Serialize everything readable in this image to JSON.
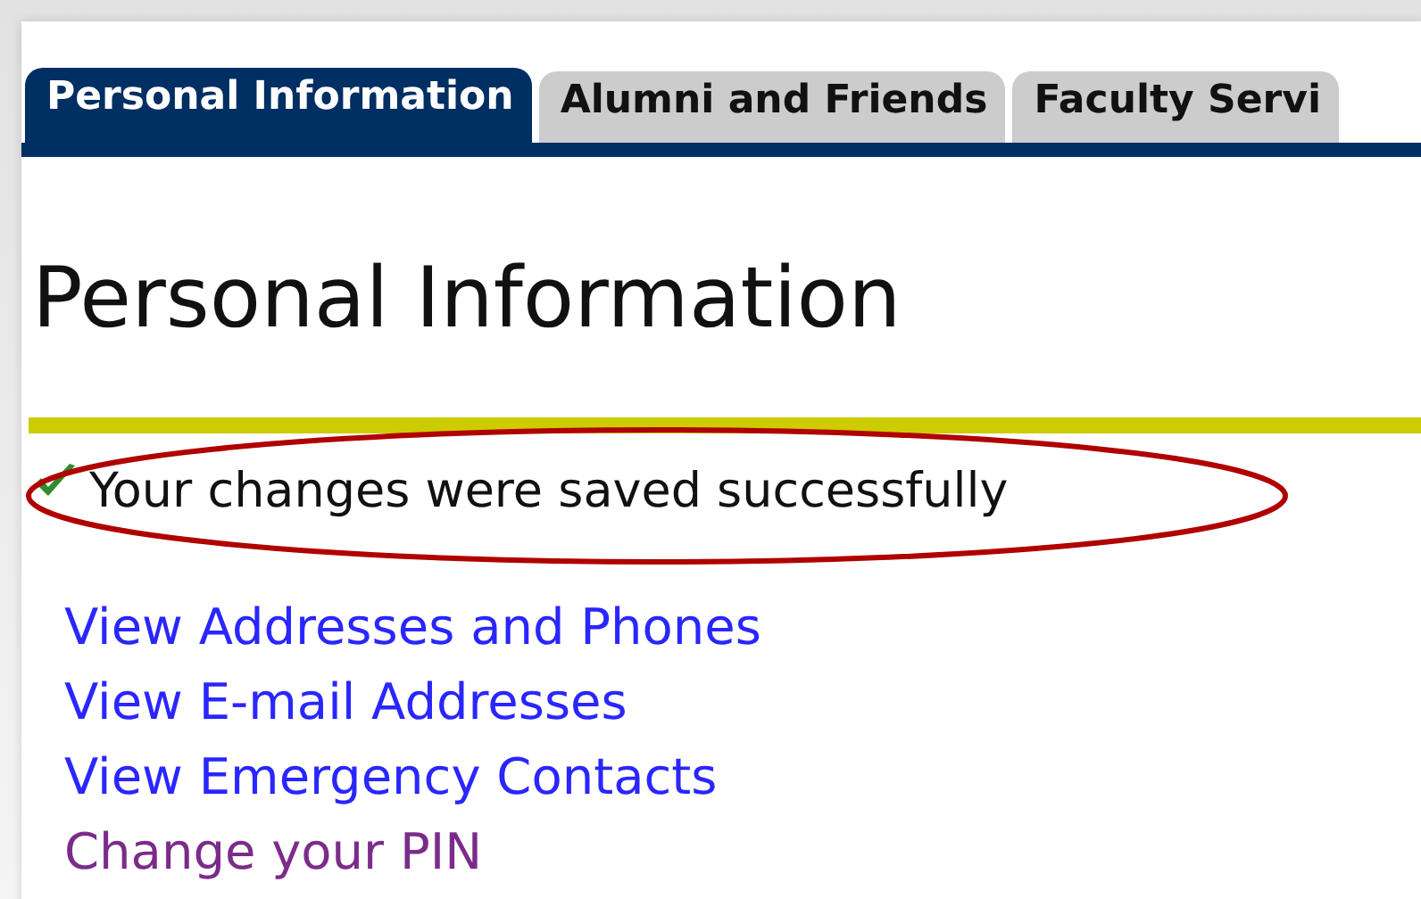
{
  "tabs": [
    {
      "label": "Personal Information",
      "selected": true
    },
    {
      "label": "Alumni and Friends",
      "selected": false
    },
    {
      "label": "Faculty Servi",
      "selected": false
    }
  ],
  "heading": "Personal Information",
  "message": {
    "text": "Your changes were saved successfully",
    "highlighted": true
  },
  "links": [
    {
      "label": "View Addresses and Phones",
      "visited": false
    },
    {
      "label": "View E-mail Addresses",
      "visited": false
    },
    {
      "label": "View Emergency Contacts",
      "visited": false
    },
    {
      "label": "Change your PIN",
      "visited": true
    }
  ]
}
